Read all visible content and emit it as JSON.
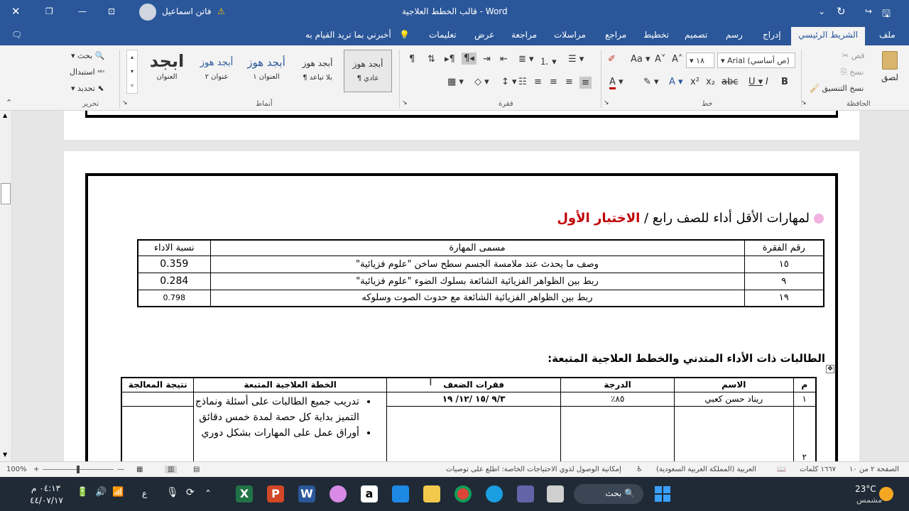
{
  "titlebar": {
    "app_title": "قالب الخطط العلاجية  -  Word",
    "user_name": "فاتن اسماعيل",
    "warning_icon": "warning-icon"
  },
  "tabs": [
    "ملف",
    "الشريط الرئيسي",
    "إدراج",
    "رسم",
    "تصميم",
    "تخطيط",
    "مراجع",
    "مراسلات",
    "مراجعة",
    "عرض",
    "تعليمات"
  ],
  "tell_me": "أخبرني بما تريد القيام به",
  "ribbon": {
    "clipboard": {
      "paste": "لصق",
      "cut": "قص",
      "copy": "نسخ",
      "format_painter": "نسخ التنسيق",
      "label": "الحافظة"
    },
    "font": {
      "name": "Arial (ص أساسي)",
      "size": "١٨",
      "label": "خط"
    },
    "paragraph": {
      "label": "فقرة"
    },
    "styles": {
      "items": [
        {
          "preview": "أبجد هوز",
          "name": "¶ عادي"
        },
        {
          "preview": "أبجد هوز",
          "name": "¶ بلا تباعد"
        },
        {
          "preview": "أبجد هوز",
          "name": "العنوان ١"
        },
        {
          "preview": "أبجد هوز",
          "name": "عنوان ٢"
        },
        {
          "preview": "ابجد",
          "name": "العنوان"
        }
      ],
      "label": "أنماط"
    },
    "editing": {
      "find": "بحث",
      "replace": "استبدال",
      "select": "تحديد",
      "label": "تحرير"
    }
  },
  "document": {
    "heading_prefix": "لمهارات  الأقل أداء للصف رابع / ",
    "heading_red": "الاختبار الأول",
    "skills_table": {
      "headers": [
        "رقم الفقرة",
        "مسمى المهارة",
        "نسبة الاداء"
      ],
      "rows": [
        [
          "١٥",
          "وصف ما يحدث عند ملامسة الجسم سطح ساخن \"علوم فزيائية\"",
          "0.359"
        ],
        [
          "٩",
          "ربط بين الظواهر الفزيائية الشائعة بسلوك الضوء \"علوم فزيائية\"",
          "0.284"
        ],
        [
          "١٩",
          "ربط بين الظواهر الفزيائية الشائعة مع حدوث الصوت وسلوكه",
          "0.798"
        ]
      ]
    },
    "section_heading": "الطالبات ذات الأداء المتدني والخطط العلاجية المتبعة:",
    "students_table": {
      "headers": [
        "م",
        "الاسم",
        "الدرجة",
        "فقرات الضعف",
        "الخطة العلاجية المتبعة",
        "نتيجة المعالجة"
      ],
      "row1": {
        "num": "١",
        "name": "ريناد حسن كعبي",
        "grade": "٨٥٪",
        "weak": "٩/٣ /١٥ /١٢/ ١٩"
      },
      "row2_num": "٢",
      "plan_items": [
        "تدريب جميع الطالبات على أسئلة ونماذج التميز بداية كل حصة لمدة خمس دقائق",
        "أوراق عمل على المهارات بشكل دوري"
      ]
    }
  },
  "status": {
    "page": "الصفحة ٢ من ١٠",
    "words": "١٦٦٧ كلمات",
    "language": "العربية (المملكة العربية السعودية)",
    "accessibility": "إمكانية الوصول لذوي الاحتياجات الخاصة: اطلع على توصيات",
    "zoom": "100%"
  },
  "taskbar": {
    "weather_temp": "23°C",
    "weather_desc": "مشمس",
    "search": "بحث",
    "time": "٠٤:١٣ م",
    "date": "٤٤/٠٧/١٧",
    "lang": "ع"
  },
  "colors": {
    "word_blue": "#2b579a",
    "red": "#c00000",
    "taskbar": "#1f2a36"
  }
}
